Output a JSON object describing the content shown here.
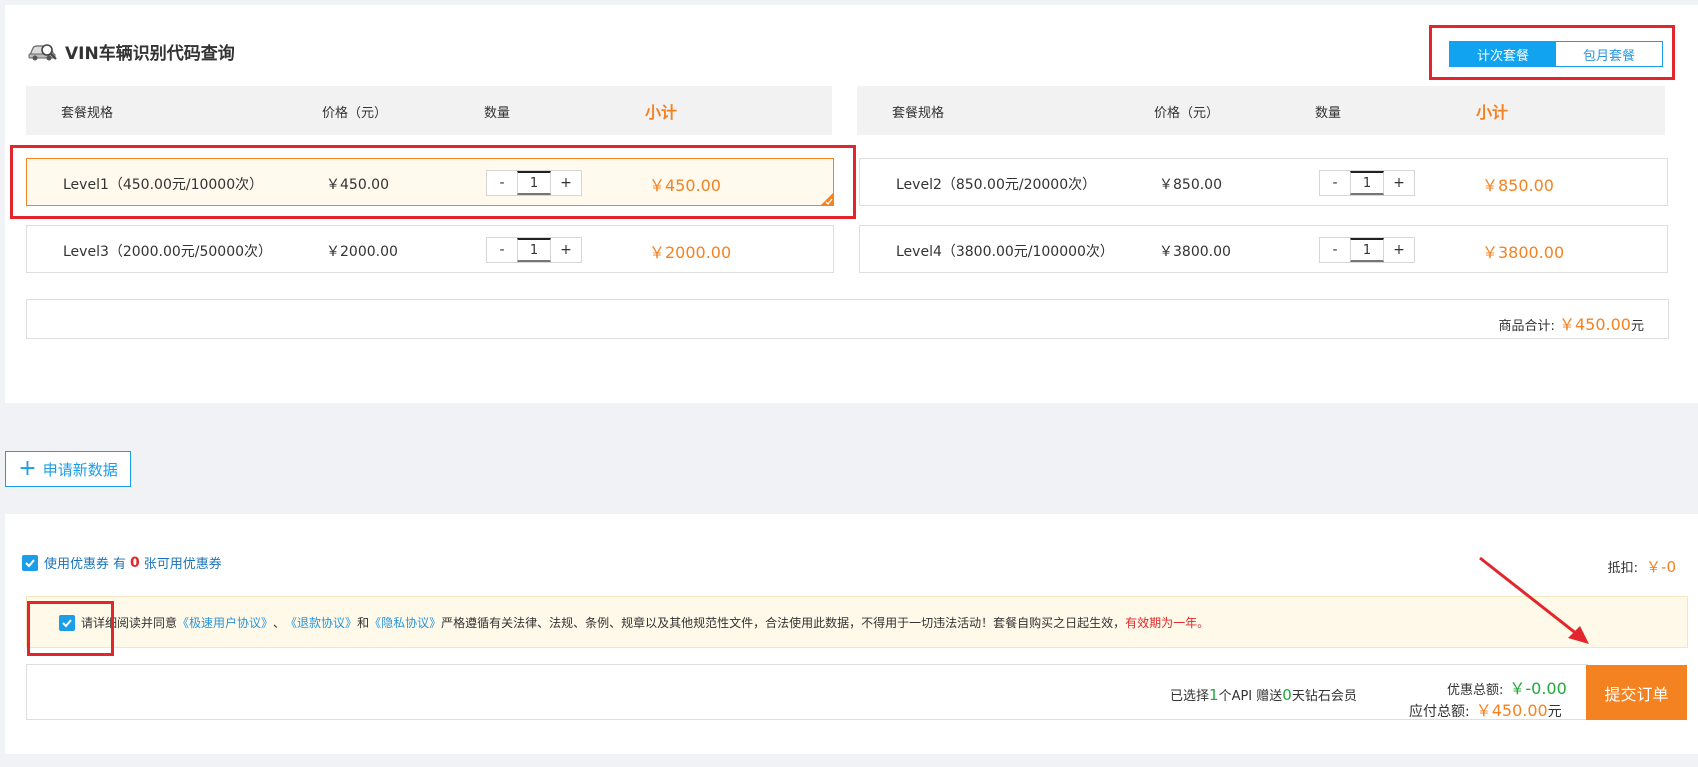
{
  "header": {
    "title": "VIN车辆识别代码查询"
  },
  "plan_toggle": {
    "per_use": "计次套餐",
    "monthly": "包月套餐"
  },
  "table_headers": {
    "spec": "套餐规格",
    "price": "价格（元）",
    "qty": "数量",
    "subtotal": "小计"
  },
  "packages": [
    {
      "spec": "Level1（450.00元/10000次）",
      "price": "￥450.00",
      "qty": "1",
      "subtotal": "￥450.00",
      "selected": true
    },
    {
      "spec": "Level2（850.00元/20000次）",
      "price": "￥850.00",
      "qty": "1",
      "subtotal": "￥850.00",
      "selected": false
    },
    {
      "spec": "Level3（2000.00元/50000次）",
      "price": "￥2000.00",
      "qty": "1",
      "subtotal": "￥2000.00",
      "selected": false
    },
    {
      "spec": "Level4（3800.00元/100000次）",
      "price": "￥3800.00",
      "qty": "1",
      "subtotal": "￥3800.00",
      "selected": false
    }
  ],
  "stepper": {
    "minus": "-",
    "plus": "+"
  },
  "goods_total": {
    "label": "商品合计:",
    "amount": "￥450.00",
    "unit": "元"
  },
  "apply_button": {
    "plus": "+",
    "label": "申请新数据"
  },
  "coupon": {
    "label": "使用优惠券",
    "prefix": "有",
    "count": "0",
    "suffix": "张可用优惠券",
    "deduct_label": "抵扣:",
    "deduct_amount": "￥-0"
  },
  "agreement": {
    "t1": "请详细阅读并同意",
    "link1": "《极速用户协议》",
    "sep1": "、",
    "link2": "《退款协议》",
    "and": "和",
    "link3": "《隐私协议》",
    "t2": " 严格遵循有关法律、法规、条例、规章以及其他规范性文件，合法使用此数据，不得用于一切违法活动！套餐自购买之日起生效，",
    "red": "有效期为一年。"
  },
  "summary": {
    "selected_prefix": "已选择",
    "api_count": "1",
    "api_suffix": "个API 赠送",
    "days": "0",
    "days_suffix": "天钻石会员",
    "discount_label": "优惠总额:",
    "discount_amount": "￥-0.00",
    "payable_label": "应付总额:",
    "payable_amount": "￥450.00",
    "payable_unit": "元"
  },
  "submit_button": "提交订单",
  "colors": {
    "accent_blue": "#1a9ee8",
    "accent_orange": "#f58220",
    "highlight_red": "#e3262b",
    "green": "#1faa3a"
  }
}
